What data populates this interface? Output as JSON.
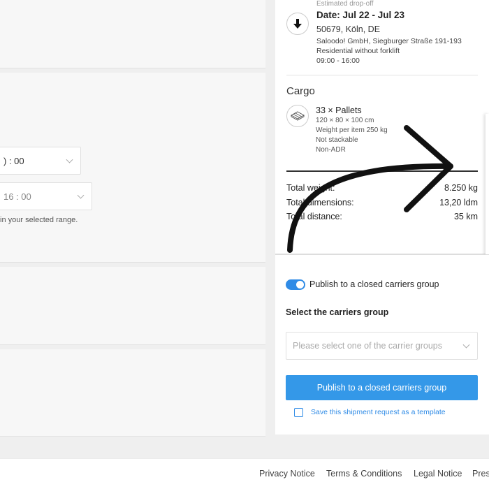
{
  "left": {
    "time_select_1": ") : 00",
    "time_select_2": "16 : 00",
    "range_note": "in your selected range."
  },
  "dropoff": {
    "label": "Estimated drop-off",
    "date": "Date: Jul 22 - Jul 23",
    "city": "50679, Köln, DE",
    "company": "Saloodo! GmbH, Siegburger Straße 191-193",
    "type": "Residential without forklift",
    "hours": "09:00 - 16:00"
  },
  "cargo": {
    "title": "Cargo",
    "qty": "33 × Pallets",
    "dims": "120 × 80 × 100 cm",
    "weight": "Weight per item 250 kg",
    "stackable": "Not stackable",
    "adr": "Non-ADR"
  },
  "totals": {
    "weight_label": "Total weight:",
    "weight_value": "8.250 kg",
    "dims_label": "Total dimensions:",
    "dims_value": "13,20 ldm",
    "dist_label": "Total distance:",
    "dist_value": "35 km"
  },
  "publish": {
    "toggle_label": "Publish to a closed carriers group",
    "toggle_on": true,
    "group_label": "Select the carriers group",
    "group_placeholder": "Please select one of the carrier groups",
    "button_label": "Publish to a closed carriers group",
    "template_label": "Save this shipment request as a template"
  },
  "footer": {
    "privacy": "Privacy Notice",
    "terms": "Terms & Conditions",
    "legal": "Legal Notice",
    "press": "Press"
  },
  "colors": {
    "accent": "#3498e8",
    "panel": "#f7f7f7",
    "background": "#efefef"
  },
  "icons": {
    "dropoff": "arrow-down-icon",
    "cargo": "pallet-icon",
    "overlay": "curved-arrow-icon"
  }
}
